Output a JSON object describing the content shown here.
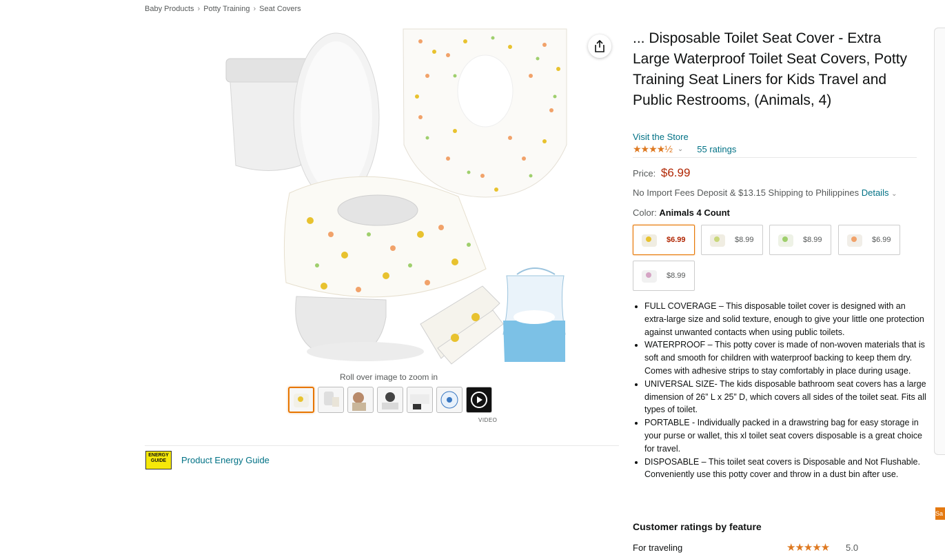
{
  "breadcrumb": [
    "Baby Products",
    "Potty Training",
    "Seat Covers"
  ],
  "product": {
    "title": "... Disposable Toilet Seat Cover - Extra Large Waterproof Toilet Seat Covers, Potty Training Seat Liners for Kids Travel and Public Restrooms, (Animals, 4)",
    "store_link": "Visit the Store",
    "rating_stars": "★★★★½",
    "ratings_count": "55 ratings",
    "price_label": "Price:",
    "price": "$6.99",
    "shipping": "No Import Fees Deposit & $13.15 Shipping to Philippines",
    "shipping_details": "Details",
    "color_label": "Color:",
    "color_value": "Animals 4 Count"
  },
  "swatches": [
    {
      "price": "$6.99",
      "selected": true
    },
    {
      "price": "$8.99",
      "selected": false
    },
    {
      "price": "$8.99",
      "selected": false
    },
    {
      "price": "$6.99",
      "selected": false
    },
    {
      "price": "$8.99",
      "selected": false
    }
  ],
  "bullets": [
    "FULL COVERAGE – This disposable toilet cover is designed with an extra-large size and solid texture, enough to give your little one protection against unwanted contacts when using public toilets.",
    "WATERPROOF – This potty cover is made of non-woven materials that is soft and smooth for children with waterproof backing to keep them dry. Comes with adhesive strips to stay comfortably in place during usage.",
    "UNIVERSAL SIZE- The kids disposable bathroom seat covers has a large dimension of 26” L x 25” D, which covers all sides of the toilet seat. Fits all types of toilet.",
    "PORTABLE - Individually packed in a drawstring bag for easy storage in your purse or wallet, this xl toilet seat covers disposable is a great choice for travel.",
    "DISPOSABLE – This toilet seat covers is Disposable and Not Flushable. Conveniently use this potty cover and throw in a dust bin after use."
  ],
  "gallery": {
    "zoom_hint": "Roll over image to zoom in",
    "video_label": "VIDEO",
    "thumb_count": 7
  },
  "energy_guide": {
    "badge_text": "ENERGY GUIDE",
    "link": "Product Energy Guide"
  },
  "customer_ratings": {
    "title": "Customer ratings by feature",
    "rows": [
      {
        "label": "For traveling",
        "stars": "★★★★★",
        "value": "5.0"
      }
    ]
  },
  "side_tag": "Sa",
  "colors": {
    "link": "#007185",
    "price": "#b12704",
    "star": "#de7921",
    "selected_border": "#e77600"
  }
}
